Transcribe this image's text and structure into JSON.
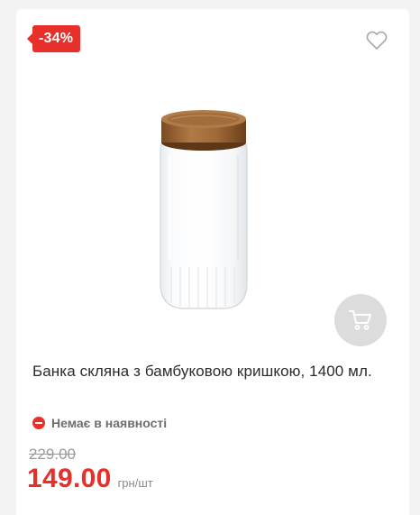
{
  "product": {
    "discount_badge": "-34%",
    "title": "Банка скляна з бамбуковою кришкою, 1400 мл.",
    "availability": "Немає в наявності",
    "old_price": "229.00",
    "price": "149.00",
    "unit": "грн/шт"
  },
  "icons": {
    "favorite": "heart-outline-icon",
    "cart": "shopping-cart-icon",
    "availability": "minus-circle-icon"
  },
  "colors": {
    "accent": "#e8302a",
    "cart_button_bg": "#dcdcdc",
    "text_muted": "#9a9a9a"
  }
}
